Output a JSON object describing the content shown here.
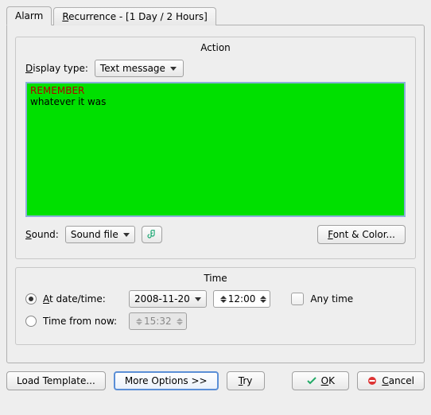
{
  "tabs": {
    "alarm": "Alarm",
    "recurrence_pre": "R",
    "recurrence_rest": "ecurrence - [1 Day / 2 Hours]"
  },
  "action": {
    "group_title": "Action",
    "display_type_pre": "D",
    "display_type_rest": "isplay type:",
    "display_type_value": "Text message",
    "message_line1": "REMEMBER",
    "message_line2": "whatever it was",
    "sound_pre": "S",
    "sound_rest": "ound:",
    "sound_value": "Sound file",
    "font_color_pre": "F",
    "font_color_rest": "ont & Color..."
  },
  "time": {
    "group_title": "Time",
    "at_pre": "A",
    "at_rest": "t date/time:",
    "date_value": "2008-11-20",
    "time_value": "12:00",
    "any_time": "Any time",
    "from_now_pre": "",
    "from_now_label": "Time from now:",
    "from_now_value": "15:32"
  },
  "footer": {
    "load_template": "Load Template...",
    "more_options": "More Options >>",
    "try_pre": "T",
    "try_rest": "ry",
    "ok_pre": "O",
    "ok_rest": "K",
    "cancel_pre": "C",
    "cancel_rest": "ancel"
  }
}
